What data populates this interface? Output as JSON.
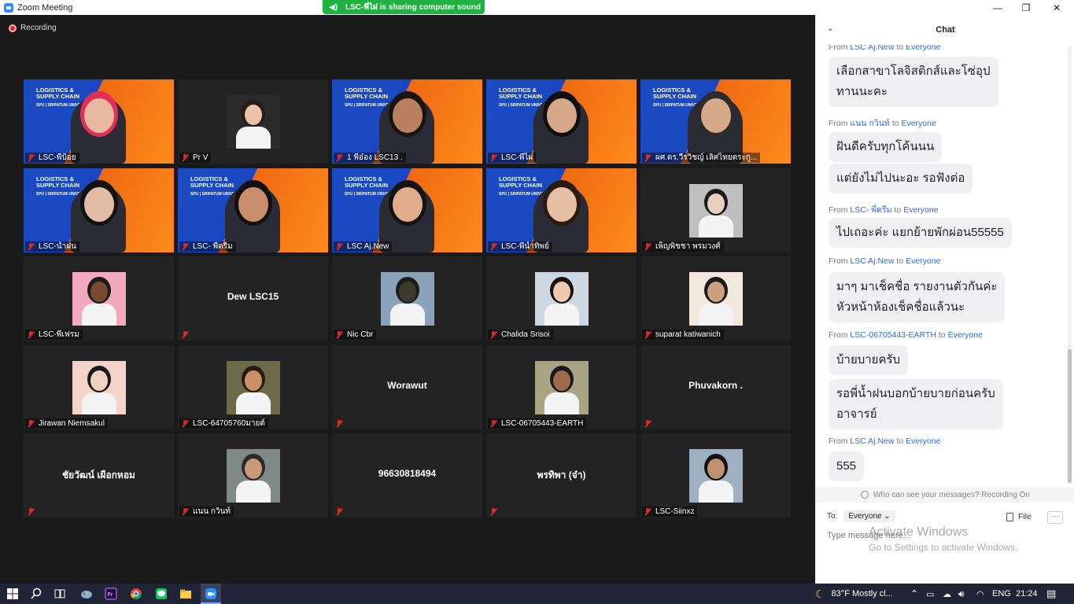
{
  "window": {
    "title": "Zoom Meeting",
    "minimize": "—",
    "maximize": "❐",
    "close": "✕"
  },
  "share_banner": {
    "text": "LSC-พี่ไผ่ is sharing computer sound"
  },
  "recording": {
    "label": "Recording"
  },
  "tiles": [
    {
      "name": "LSC-พี่ป้อย",
      "kind": "banner",
      "skin": "#e8b8a0",
      "hair": "#e0305a"
    },
    {
      "name": "Pr V",
      "kind": "avatar",
      "bg": "#2a2a2a",
      "skin": "#e8c3a8",
      "hair": "#2a1b14"
    },
    {
      "name": "1 พี่อ๋อง LSC13 .",
      "kind": "banner",
      "skin": "#b9805f",
      "hair": "#1a1410"
    },
    {
      "name": "LSC-พี่ไผ่",
      "kind": "banner",
      "skin": "#d7a889",
      "hair": "#0f0f0f"
    },
    {
      "name": "ผศ.ดร.วีรวิชญ์ เลิศไทยตระกู...",
      "kind": "banner",
      "skin": "#d6a98a",
      "hair": "#2c2c2c"
    },
    {
      "name": "LSC-น้ำฝน",
      "kind": "banner",
      "skin": "#e2bca6",
      "hair": "#111111",
      "active": true
    },
    {
      "name": "LSC- พี่ดรีม",
      "kind": "banner",
      "skin": "#c98f6c",
      "hair": "#111111"
    },
    {
      "name": "LSC Aj.New",
      "kind": "banner",
      "skin": "#e1ad8e",
      "hair": "#141414"
    },
    {
      "name": "LSC-พี่น้ำทิพย์",
      "kind": "banner",
      "skin": "#e5c0a5",
      "hair": "#2b1a10"
    },
    {
      "name": "เพ็ญพิชชา พรมวงศ์",
      "kind": "avatar",
      "bg": "#bfbfbf",
      "skin": "#e8d0c0",
      "hair": "#1a1a1a"
    },
    {
      "name": "LSC-พี่เฟรม",
      "kind": "avatar",
      "bg": "#f3a8c0",
      "skin": "#7a4a30",
      "hair": "#1c1c1c"
    },
    {
      "name": "",
      "kind": "text",
      "bigname": "Dew LSC15"
    },
    {
      "name": "Nic Cbr",
      "kind": "avatar",
      "bg": "#8aa3b8",
      "skin": "#3b3b2d",
      "hair": "#1c1c1c"
    },
    {
      "name": "Chalida Srisoi",
      "kind": "avatar",
      "bg": "#cfd8e0",
      "skin": "#efc9b1",
      "hair": "#1a1010"
    },
    {
      "name": "suparat katiwanich",
      "kind": "avatar",
      "bg": "#f2e7dc",
      "skin": "#caa07e",
      "hair": "#1a1a1a"
    },
    {
      "name": "Jirawan Niemsakul",
      "kind": "avatar",
      "bg": "#f6d3c9",
      "skin": "#f0d2c0",
      "hair": "#1a1a1a"
    },
    {
      "name": "LSC-64705760มายด์",
      "kind": "avatar",
      "bg": "#6b6a4a",
      "skin": "#c9906a",
      "hair": "#2b1a10"
    },
    {
      "name": "",
      "kind": "text",
      "bigname": "Worawut"
    },
    {
      "name": "LSC-06705443-EARTH",
      "kind": "avatar",
      "bg": "#a8a484",
      "skin": "#9d6a4c",
      "hair": "#1a1a1a"
    },
    {
      "name": "",
      "kind": "text",
      "bigname": "Phuvakorn ."
    },
    {
      "name": "",
      "kind": "text",
      "bigname": "ชัยวัฒน์ เผือกหอม"
    },
    {
      "name": "แนน กวินท์",
      "kind": "avatar",
      "bg": "#7f8a86",
      "skin": "#c79a7a",
      "hair": "#2a2a2a"
    },
    {
      "name": "",
      "kind": "text",
      "bigname": "96630818494"
    },
    {
      "name": "",
      "kind": "text",
      "bigname": "พรทิพา (จ๋า)"
    },
    {
      "name": "LSC-Siinxz",
      "kind": "avatar",
      "bg": "#9fb0c4",
      "skin": "#c09070",
      "hair": "#111111"
    }
  ],
  "banner": {
    "line1": "LOGISTICS &",
    "line2": "SUPPLY CHAIN",
    "sub": "SPU | SRIPATUM UNIVERSITY"
  },
  "chat": {
    "title": "Chat",
    "messages": [
      {
        "from": "LSC Aj.New",
        "to": "Everyone",
        "bubbles": [
          [
            "เลือกสาขาโลจิสติกส์และโซ่อุป",
            "ทานนะคะ"
          ]
        ]
      },
      {
        "from": "แนน กวินท์",
        "to": "Everyone",
        "bubbles": [
          [
            "ฝันดีครับทุกโค้นนน"
          ],
          [
            "แต่ยังไม่ไปนะอะ รอฟังต่อ"
          ]
        ]
      },
      {
        "from": "LSC- พี่ดรีม",
        "to": "Everyone",
        "bubbles": [
          [
            "ไปเถอะค่ะ แยกย้ายพักผ่อน55555"
          ]
        ]
      },
      {
        "from": "LSC Aj.New",
        "to": "Everyone",
        "bubbles": [
          [
            "มาๆ มาเช็คชื่อ รายงานตัวกันค่ะ",
            "หัวหน้าห้องเช็คชื่อแล้วนะ"
          ]
        ]
      },
      {
        "from": "LSC-06705443-EARTH",
        "to": "Everyone",
        "bubbles": [
          [
            "บ้ายบายครับ"
          ],
          [
            "รอพี่น้ำฝนบอกบ้ายบายก่อนครับ",
            "อาจารย์"
          ]
        ]
      },
      {
        "from": "LSC Aj.New",
        "to": "Everyone",
        "bubbles": [
          [
            "555"
          ]
        ]
      }
    ],
    "from_word": "From",
    "to_word": "to",
    "privacy": "Who can see your messages? Recording On",
    "to_label": "To:",
    "to_value": "Everyone",
    "file_label": "File",
    "more": "···",
    "input_placeholder": "Type message here..."
  },
  "watermark": {
    "line1": "Activate Windows",
    "line2": "Go to Settings to activate Windows."
  },
  "taskbar": {
    "weather": "83°F  Mostly cl...",
    "lang": "ENG",
    "time": "21:24"
  },
  "colors": {
    "zoom_blue": "#2d8cff",
    "share_green": "#1fb141",
    "active_border": "#e7e160",
    "mute_red": "#e02828",
    "link_blue": "#2b6dd4"
  }
}
